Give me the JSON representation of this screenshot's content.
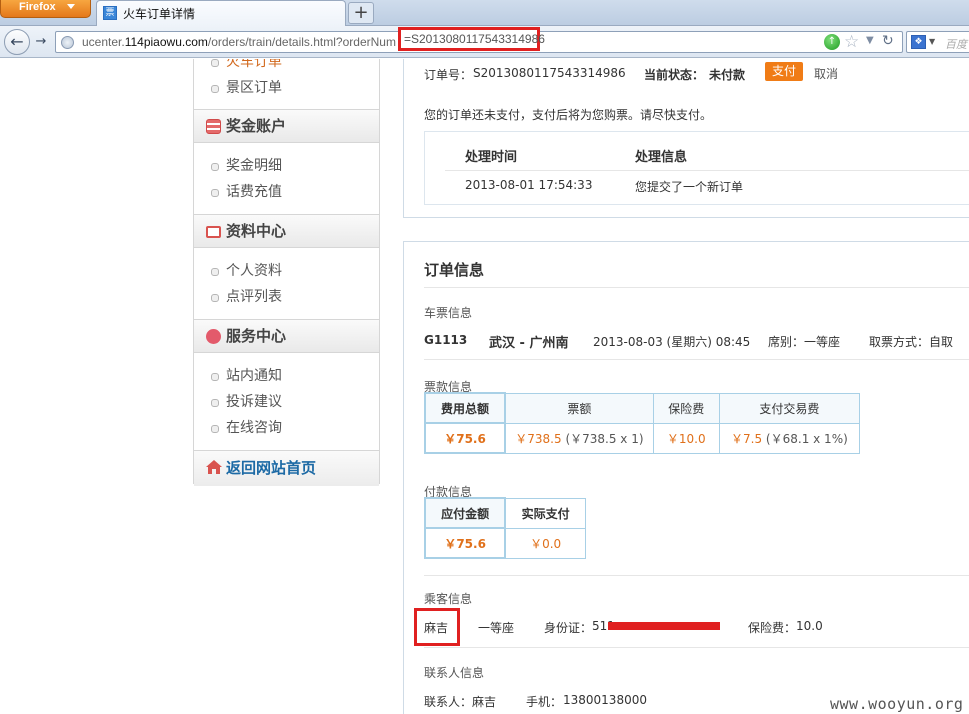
{
  "browser": {
    "menu_button": "Firefox",
    "tab_title": "火车订单详情",
    "tab_icon_glyph": "票",
    "new_tab": "+",
    "url_prefix": "ucenter.",
    "url_domain": "114piaowu.com",
    "url_path": "/orders/train/details.html?orderNum",
    "url_param_value": "=S2013080117543314986",
    "search_placeholder": "百度"
  },
  "sidebar": {
    "top_items": [
      {
        "label": "火车订单",
        "active": true
      },
      {
        "label": "景区订单",
        "active": false
      }
    ],
    "groups": [
      {
        "title": "奖金账户",
        "icon": "money-icon",
        "items": [
          "奖金明细",
          "话费充值"
        ]
      },
      {
        "title": "资料中心",
        "icon": "folder-icon",
        "items": [
          "个人资料",
          "点评列表"
        ]
      },
      {
        "title": "服务中心",
        "icon": "service-icon",
        "items": [
          "站内通知",
          "投诉建议",
          "在线咨询"
        ]
      }
    ],
    "home_link": "返回网站首页"
  },
  "order_status": {
    "order_no_label": "订单号：",
    "order_no": "S2013080117543314986",
    "status_label": "当前状态：",
    "status_value": "未付款",
    "pay_button": "支付",
    "cancel_link": "取消",
    "notice": "您的订单还未支付，支付后将为您购票。请尽快支付。",
    "log": {
      "headers": [
        "处理时间",
        "处理信息"
      ],
      "rows": [
        [
          "2013-08-01 17:54:33",
          "您提交了一个新订单"
        ]
      ]
    }
  },
  "order_info": {
    "title": "订单信息",
    "ticket_label": "车票信息",
    "train_no": "G1113",
    "route": "武汉 - 广州南",
    "depart": "2013-08-03 (星期六) 08:45",
    "seat_class": "席别：一等座",
    "pickup": "取票方式：自取",
    "fee_label": "票款信息",
    "fee_table": {
      "headers": [
        "费用总额",
        "票额",
        "保险费",
        "支付交易费"
      ],
      "values": [
        "￥75.6",
        "￥738.5",
        "￥10.0",
        "￥7.5"
      ],
      "notes": [
        "",
        "(￥738.5 x 1)",
        "",
        "(￥68.1 x 1%)"
      ]
    },
    "pay_label": "付款信息",
    "pay_table": {
      "headers": [
        "应付金额",
        "实际支付"
      ],
      "values": [
        "￥75.6",
        "￥0.0"
      ]
    },
    "passenger_label": "乘客信息",
    "passenger": {
      "name": "麻吉",
      "seat": "一等座",
      "id_label": "身份证：",
      "id_visible": "511",
      "insurance_label": "保险费：",
      "insurance": "10.0"
    },
    "contact_label": "联系人信息",
    "contact": {
      "name_label": "联系人：",
      "name": "麻吉",
      "phone_label": "手机：",
      "phone": "13800138000"
    }
  },
  "watermark": "www.wooyun.org",
  "colors": {
    "accent_orange": "#f07c16",
    "price_orange": "#e0701a",
    "highlight_red": "#e02020",
    "link_blue": "#1d6aa5",
    "table_border": "#a8d0e6"
  }
}
